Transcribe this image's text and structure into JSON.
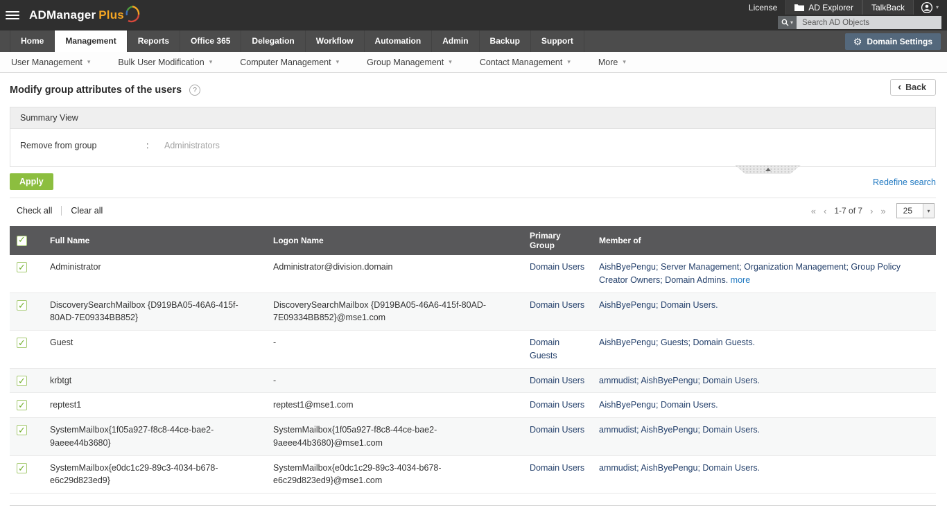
{
  "topbar": {
    "brand_primary": "ADManager",
    "brand_secondary": "Plus",
    "links": {
      "license": "License",
      "ad_explorer": "AD Explorer",
      "talkback": "TalkBack"
    },
    "search_placeholder": "Search AD Objects"
  },
  "nav": {
    "tabs": [
      {
        "label": "Home",
        "active": false
      },
      {
        "label": "Management",
        "active": true
      },
      {
        "label": "Reports",
        "active": false
      },
      {
        "label": "Office 365",
        "active": false
      },
      {
        "label": "Delegation",
        "active": false
      },
      {
        "label": "Workflow",
        "active": false
      },
      {
        "label": "Automation",
        "active": false
      },
      {
        "label": "Admin",
        "active": false
      },
      {
        "label": "Backup",
        "active": false
      },
      {
        "label": "Support",
        "active": false
      }
    ],
    "domain_settings_label": "Domain Settings"
  },
  "subnav": {
    "items": [
      "User Management",
      "Bulk User Modification",
      "Computer Management",
      "Group Management",
      "Contact Management",
      "More"
    ]
  },
  "page": {
    "title": "Modify group attributes of the users",
    "help_glyph": "?",
    "back_chevron": "‹",
    "back_label": "Back"
  },
  "summary": {
    "header": "Summary View",
    "label": "Remove from group",
    "colon": ":",
    "value": "Administrators"
  },
  "actions": {
    "apply_label": "Apply",
    "redefine_label": "Redefine search"
  },
  "list_controls": {
    "check_all": "Check all",
    "clear_all": "Clear all"
  },
  "pagination": {
    "first": "«",
    "prev": "‹",
    "range": "1-7 of 7",
    "next": "›",
    "last": "»",
    "page_size": "25"
  },
  "table": {
    "headers": [
      "Full Name",
      "Logon Name",
      "Primary Group",
      "Member of"
    ],
    "rows": [
      {
        "checked": true,
        "full_name": "Administrator",
        "logon_name": "Administrator@division.domain",
        "primary_group": "Domain Users",
        "member_of": "AishByePengu; Server Management; Organization Management; Group Policy Creator Owners; Domain Admins.",
        "more_label": "more"
      },
      {
        "checked": true,
        "full_name": "DiscoverySearchMailbox {D919BA05-46A6-415f-80AD-7E09334BB852}",
        "logon_name": "DiscoverySearchMailbox {D919BA05-46A6-415f-80AD-7E09334BB852}@mse1.com",
        "primary_group": "Domain Users",
        "member_of": "AishByePengu; Domain Users.",
        "more_label": ""
      },
      {
        "checked": true,
        "full_name": "Guest",
        "logon_name": "-",
        "primary_group": "Domain Guests",
        "member_of": "AishByePengu; Guests; Domain Guests.",
        "more_label": ""
      },
      {
        "checked": true,
        "full_name": "krbtgt",
        "logon_name": "-",
        "primary_group": "Domain Users",
        "member_of": "ammudist; AishByePengu; Domain Users.",
        "more_label": ""
      },
      {
        "checked": true,
        "full_name": "reptest1",
        "logon_name": "reptest1@mse1.com",
        "primary_group": "Domain Users",
        "member_of": "AishByePengu; Domain Users.",
        "more_label": ""
      },
      {
        "checked": true,
        "full_name": "SystemMailbox{1f05a927-f8c8-44ce-bae2-9aeee44b3680}",
        "logon_name": "SystemMailbox{1f05a927-f8c8-44ce-bae2-9aeee44b3680}@mse1.com",
        "primary_group": "Domain Users",
        "member_of": "ammudist; AishByePengu; Domain Users.",
        "more_label": ""
      },
      {
        "checked": true,
        "full_name": "SystemMailbox{e0dc1c29-89c3-4034-b678-e6c29d823ed9}",
        "logon_name": "SystemMailbox{e0dc1c29-89c3-4034-b678-e6c29d823ed9}@mse1.com",
        "primary_group": "Domain Users",
        "member_of": "ammudist; AishByePengu; Domain Users.",
        "more_label": ""
      }
    ]
  },
  "ui": {
    "caret": "▾"
  },
  "colors": {
    "topbar_bg": "#2f2f2f",
    "tabs_bg": "#4c4c4c",
    "apply_button": "#8cbe3f",
    "link": "#1f78c1",
    "table_header_bg": "#58585a",
    "member_text": "#24406b",
    "domain_settings_button": "#54687c",
    "checkbox_check": "#6fae2a"
  }
}
